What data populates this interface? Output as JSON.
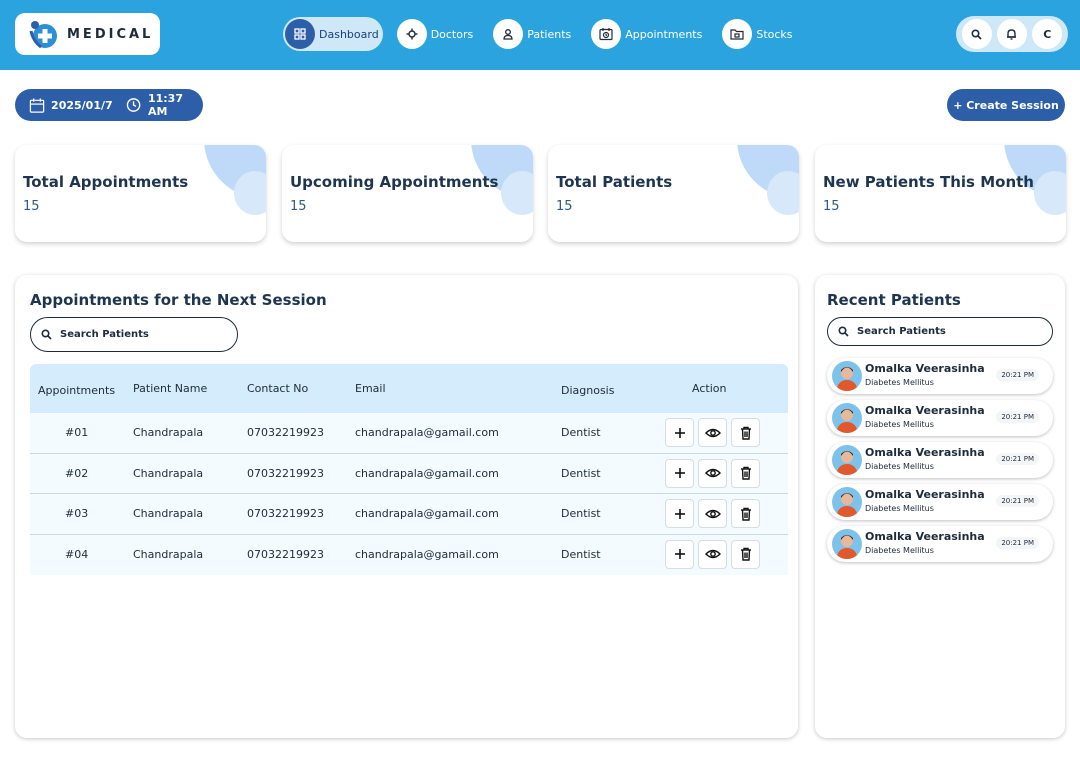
{
  "brand": {
    "name": "MEDICAL"
  },
  "nav": [
    {
      "label": "Dashboard",
      "icon": "grid-icon",
      "active": true
    },
    {
      "label": "Doctors",
      "icon": "stethoscope-icon",
      "active": false
    },
    {
      "label": "Patients",
      "icon": "user-icon",
      "active": false
    },
    {
      "label": "Appointments",
      "icon": "calendar-clock-icon",
      "active": false
    },
    {
      "label": "Stocks",
      "icon": "folder-icon",
      "active": false
    }
  ],
  "header_actions": {
    "avatar_initial": "C"
  },
  "datetime": {
    "date": "2025/01/7",
    "time": "11:37 AM"
  },
  "create_session": {
    "label": "+ Create Session"
  },
  "stats": [
    {
      "title": "Total Appointments",
      "value": "15"
    },
    {
      "title": "Upcoming Appointments",
      "value": "15"
    },
    {
      "title": "Total Patients",
      "value": "15"
    },
    {
      "title": "New Patients This Month",
      "value": "15"
    }
  ],
  "appointments": {
    "title": "Appointments for the Next Session",
    "search_placeholder": "Search Patients",
    "columns": [
      "Appointments",
      "Patient Name",
      "Contact No",
      "Email",
      "Diagnosis",
      "Action"
    ],
    "rows": [
      {
        "id": "#01",
        "name": "Chandrapala",
        "contact": "07032219923",
        "email": "chandrapala@gamail.com",
        "diagnosis": "Dentist"
      },
      {
        "id": "#02",
        "name": "Chandrapala",
        "contact": "07032219923",
        "email": "chandrapala@gamail.com",
        "diagnosis": "Dentist"
      },
      {
        "id": "#03",
        "name": "Chandrapala",
        "contact": "07032219923",
        "email": "chandrapala@gamail.com",
        "diagnosis": "Dentist"
      },
      {
        "id": "#04",
        "name": "Chandrapala",
        "contact": "07032219923",
        "email": "chandrapala@gamail.com",
        "diagnosis": "Dentist"
      }
    ]
  },
  "recent": {
    "title": "Recent Patients",
    "search_placeholder": "Search Patients",
    "patients": [
      {
        "name": "Omalka Veerasinha",
        "diagnosis": "Diabetes Mellitus",
        "time": "20:21 PM"
      },
      {
        "name": "Omalka Veerasinha",
        "diagnosis": "Diabetes Mellitus",
        "time": "20:21 PM"
      },
      {
        "name": "Omalka Veerasinha",
        "diagnosis": "Diabetes Mellitus",
        "time": "20:21 PM"
      },
      {
        "name": "Omalka Veerasinha",
        "diagnosis": "Diabetes Mellitus",
        "time": "20:21 PM"
      },
      {
        "name": "Omalka Veerasinha",
        "diagnosis": "Diabetes Mellitus",
        "time": "20:21 PM"
      }
    ]
  },
  "colors": {
    "topbar": "#2aa3df",
    "primary": "#2d5fa8",
    "accent_light": "#cfe8f8",
    "table_header": "#d4ecfb"
  }
}
